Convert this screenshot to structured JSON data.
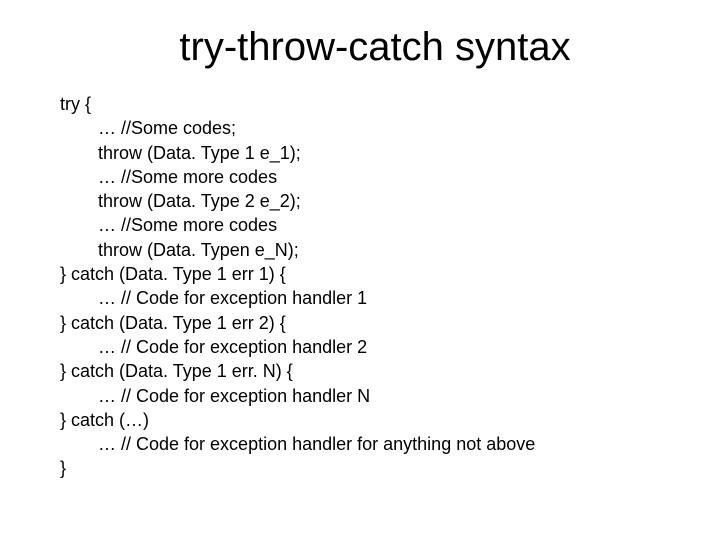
{
  "title": "try-throw-catch syntax",
  "lines": {
    "l0": "try {",
    "l1": "… //Some codes;",
    "l2": "throw (Data. Type 1 e_1);",
    "l3": "… //Some more codes",
    "l4": "throw (Data. Type 2 e_2);",
    "l5": "… //Some more codes",
    "l6": "throw (Data. Typen e_N);",
    "l7": "} catch (Data. Type 1 err 1) {",
    "l8": "… // Code for exception handler 1",
    "l9": "} catch (Data. Type 1 err 2) {",
    "l10": "… // Code for exception handler 2",
    "l11": "} catch (Data. Type 1 err. N) {",
    "l12": "… // Code for exception handler N",
    "l13": "} catch (…)",
    "l14": "… // Code for exception handler for anything not above",
    "l15": "}"
  }
}
